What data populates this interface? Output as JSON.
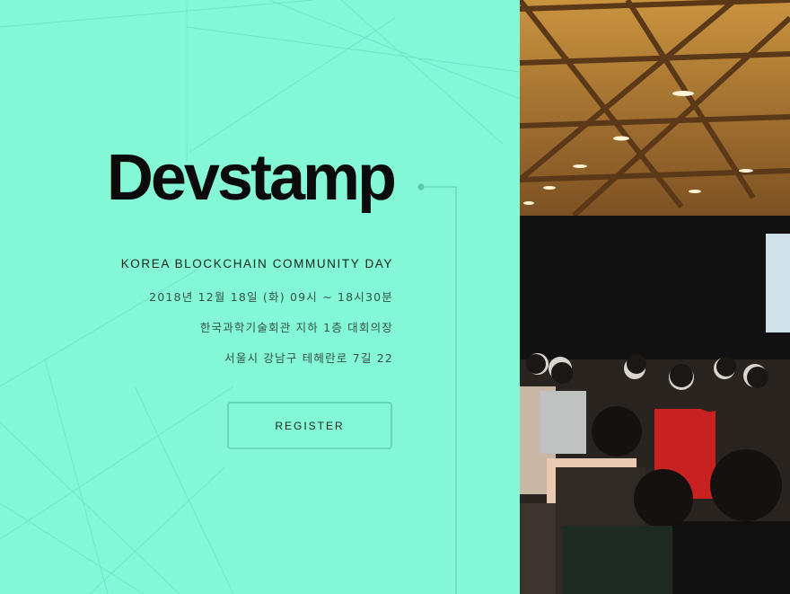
{
  "brand": {
    "logo_text": "Devstamp"
  },
  "event": {
    "title": "KOREA BLOCKCHAIN COMMUNITY DAY",
    "date_time": "2018년 12월 18일 (화) 09시 ~ 18시30분",
    "venue": "한국과학기술회관 지하 1층 대회의장",
    "address": "서울시 강남구 테헤란로 7길 22"
  },
  "cta": {
    "register_label": "REGISTER"
  },
  "colors": {
    "accent": "#84f7d6",
    "text_dark": "#0b0b0b",
    "button_border": "#69d8b8"
  },
  "photo": {
    "subject": "conference-audience-photo"
  }
}
